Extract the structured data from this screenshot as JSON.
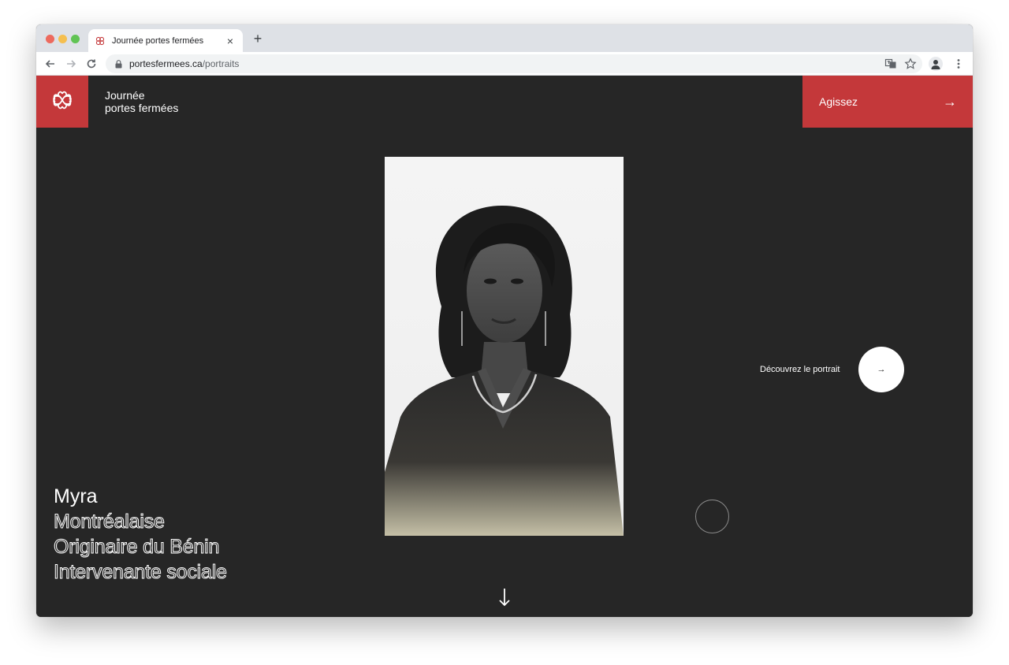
{
  "browser": {
    "tab_title": "Journée portes fermées",
    "tab_close": "×",
    "new_tab": "+",
    "url_host": "portesfermees.ca",
    "url_path": "/portraits",
    "icons": [
      "back-icon",
      "forward-icon",
      "reload-icon",
      "lock-icon",
      "translate-icon",
      "star-icon",
      "profile-icon",
      "menu-icon"
    ]
  },
  "header": {
    "brand_line1": "Journée",
    "brand_line2": "portes fermées",
    "cta_label": "Agissez",
    "cta_arrow": "→"
  },
  "portrait": {
    "discover_label": "Découvrez le portrait",
    "discover_arrow": "→",
    "name": "Myra",
    "details": [
      "Montréalaise",
      "Originaire du Bénin",
      "Intervenante sociale"
    ]
  },
  "colors": {
    "accent": "#c4383a",
    "background": "#262626"
  }
}
